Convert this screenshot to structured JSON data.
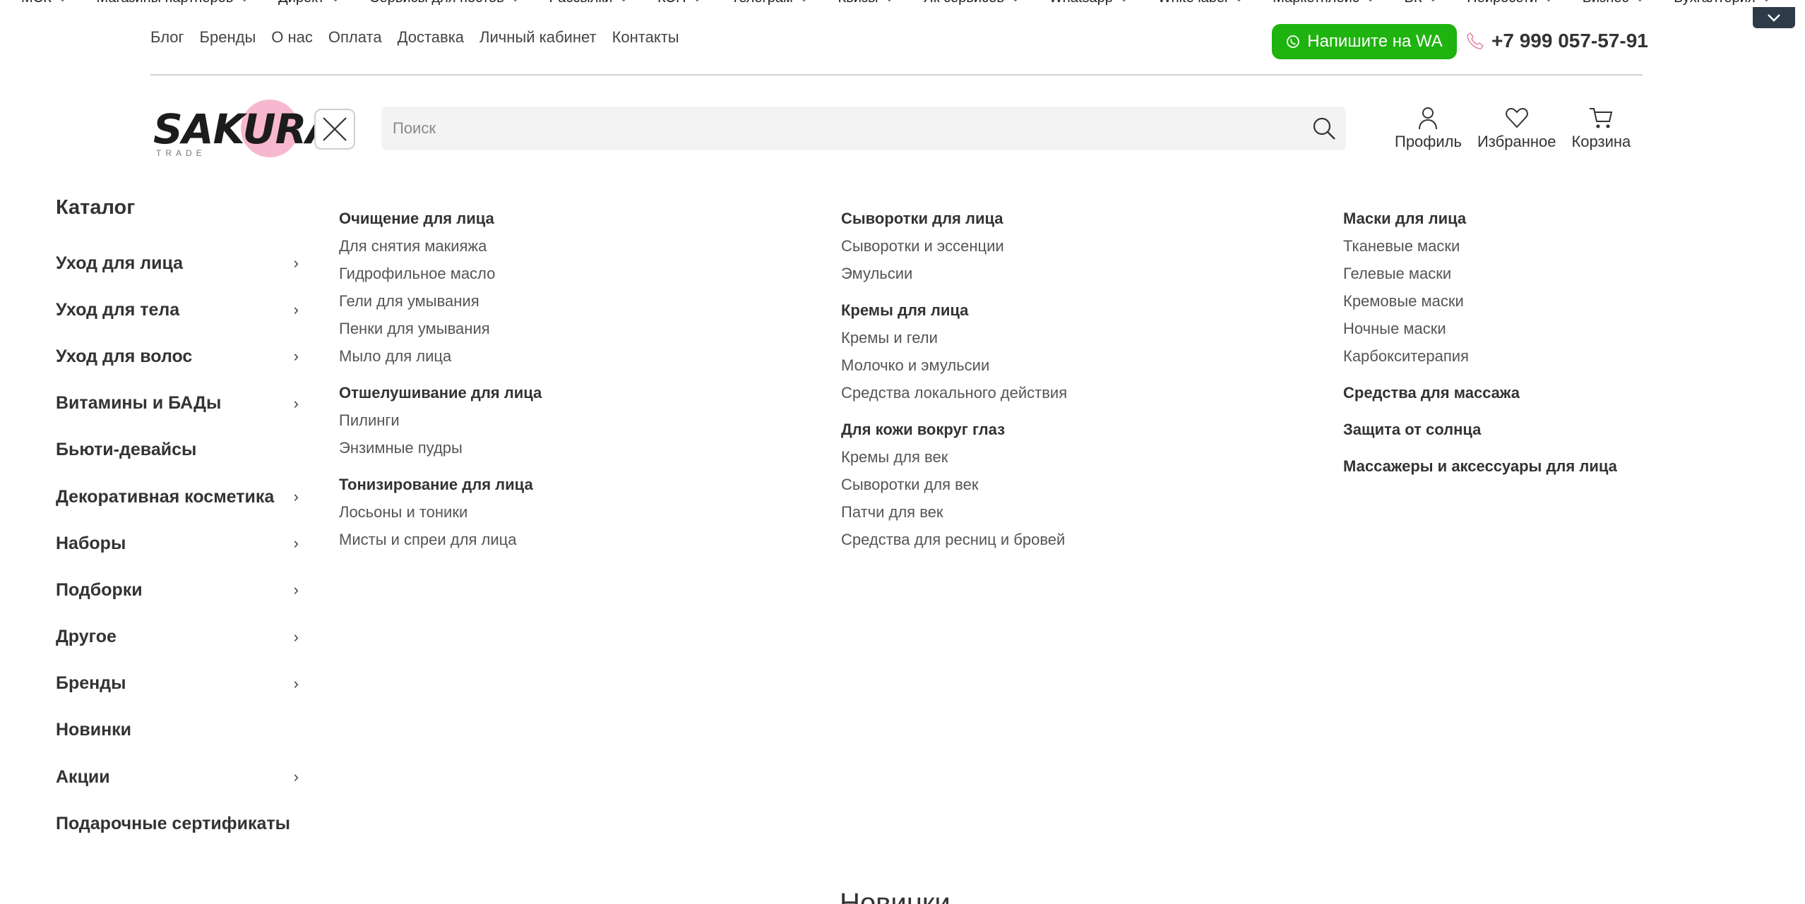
{
  "partner_strip": {
    "items": [
      "МСК",
      "Магазины партнеров",
      "Директ",
      "Сервисы для постов",
      "Рассылки",
      "КЭП",
      "Телеграм",
      "Квизы",
      "Як сервисов",
      "Whatsapp",
      "White label",
      "Маркетплейс",
      "ВК",
      "Нейросети",
      "Бизнес",
      "Бухгалтерия"
    ]
  },
  "topnav": [
    "Блог",
    "Бренды",
    "О нас",
    "Оплата",
    "Доставка",
    "Личный кабинет",
    "Контакты"
  ],
  "wa_button": "Напишите на WA",
  "phone": "+7 999 057-57-91",
  "logo": {
    "word": "SAKURA",
    "sub": "TRADE"
  },
  "search": {
    "placeholder": "Поиск"
  },
  "actions": {
    "profile": "Профиль",
    "favorites": "Избранное",
    "cart": "Корзина"
  },
  "catalog": {
    "title": "Каталог",
    "items": [
      {
        "label": "Уход для лица",
        "has_sub": true
      },
      {
        "label": "Уход для тела",
        "has_sub": true
      },
      {
        "label": "Уход для волос",
        "has_sub": true
      },
      {
        "label": "Витамины и БАДы",
        "has_sub": true
      },
      {
        "label": "Бьюти-девайсы",
        "has_sub": false
      },
      {
        "label": "Декоративная косметика",
        "has_sub": true
      },
      {
        "label": "Наборы",
        "has_sub": true
      },
      {
        "label": "Подборки",
        "has_sub": true
      },
      {
        "label": "Другое",
        "has_sub": true
      },
      {
        "label": "Бренды",
        "has_sub": true
      },
      {
        "label": "Новинки",
        "has_sub": false
      },
      {
        "label": "Акции",
        "has_sub": true
      },
      {
        "label": "Подарочные сертификаты",
        "has_sub": false
      }
    ]
  },
  "submenu": {
    "col1": [
      {
        "title": "Очищение для лица",
        "links": [
          "Для снятия макияжа",
          "Гидрофильное масло",
          "Гели для умывания",
          "Пенки для умывания",
          "Мыло для лица"
        ]
      },
      {
        "title": "Отшелушивание для лица",
        "links": [
          "Пилинги",
          "Энзимные пудры"
        ]
      },
      {
        "title": "Тонизирование для лица",
        "links": [
          "Лосьоны и тоники",
          "Мисты и спреи для лица"
        ]
      }
    ],
    "col2": [
      {
        "title": "Сыворотки для лица",
        "links": [
          "Сыворотки и эссенции",
          "Эмульсии"
        ]
      },
      {
        "title": "Кремы для лица",
        "links": [
          "Кремы и гели",
          "Молочко и эмульсии",
          "Средства локального действия"
        ]
      },
      {
        "title": "Для кожи вокруг глаз",
        "links": [
          "Кремы для век",
          "Сыворотки для век",
          "Патчи для век",
          "Средства для ресниц и бровей"
        ]
      }
    ],
    "col3": [
      {
        "title": "Маски для лица",
        "links": [
          "Тканевые маски",
          "Гелевые маски",
          "Кремовые маски",
          "Ночные маски",
          "Карбокситерапия"
        ]
      },
      {
        "title": "Средства для массажа",
        "links": []
      },
      {
        "title": "Защита от солнца",
        "links": []
      },
      {
        "title": "Массажеры и аксессуары для лица",
        "links": []
      }
    ]
  },
  "section_heading": "Новинки",
  "colors": {
    "wa_green": "#1fb30f",
    "logo_pink": "#f7b8cf",
    "toggle_bg": "#2f3a48"
  }
}
